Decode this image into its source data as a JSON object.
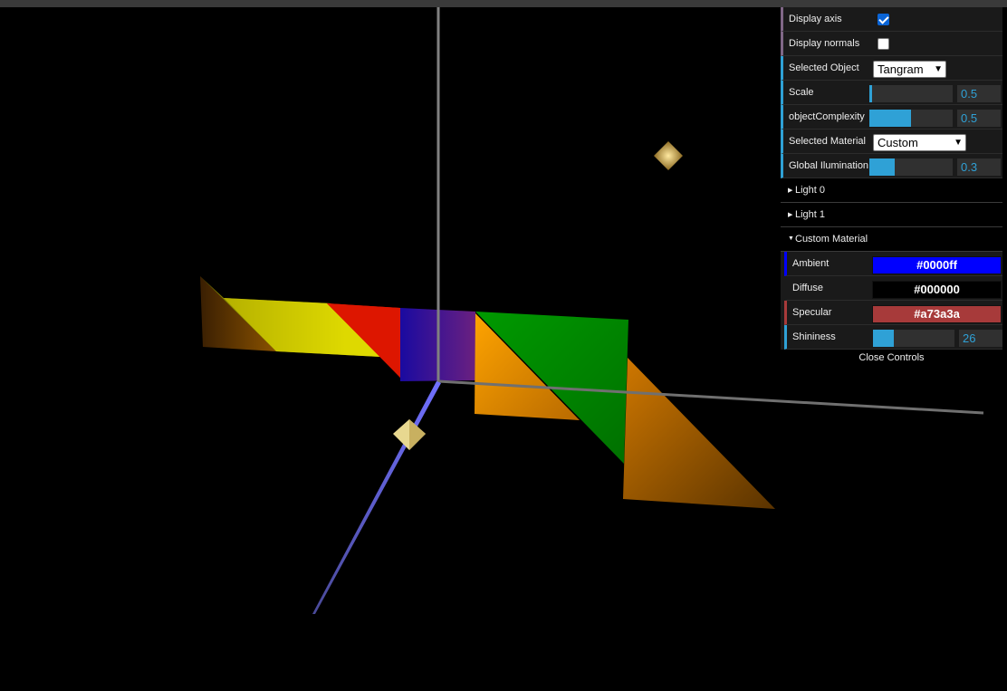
{
  "gui": {
    "display_axis": {
      "label": "Display axis",
      "checked": true
    },
    "display_normals": {
      "label": "Display normals",
      "checked": false
    },
    "selected_object": {
      "label": "Selected Object",
      "value": "Tangram"
    },
    "scale": {
      "label": "Scale",
      "value": "0.5",
      "fraction": 0.03
    },
    "object_complexity": {
      "label": "objectComplexity",
      "value": "0.5",
      "fraction": 0.5
    },
    "selected_material": {
      "label": "Selected Material",
      "value": "Custom"
    },
    "global_illumination": {
      "label": "Global Ilumination",
      "value": "0.3",
      "fraction": 0.3
    },
    "light0": {
      "label": "Light 0"
    },
    "light1": {
      "label": "Light 1"
    },
    "custom_material": {
      "label": "Custom Material",
      "ambient": {
        "label": "Ambient",
        "value": "#0000ff",
        "color": "#0000ff"
      },
      "diffuse": {
        "label": "Diffuse",
        "value": "#000000",
        "color": "#000000"
      },
      "specular": {
        "label": "Specular",
        "value": "#a73a3a",
        "color": "#a73a3a"
      },
      "shininess": {
        "label": "Shininess",
        "value": "26",
        "fraction": 0.25
      }
    },
    "close_label": "Close Controls"
  }
}
